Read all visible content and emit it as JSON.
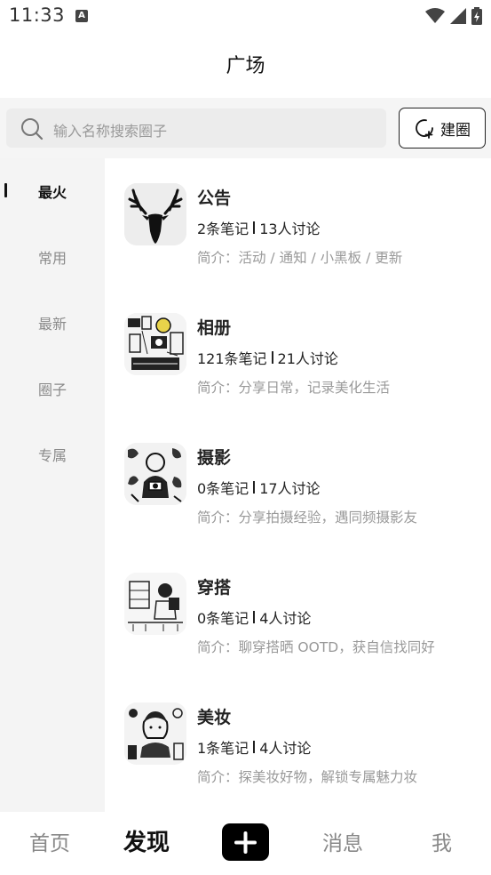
{
  "status_bar": {
    "time": "11:33",
    "app_icon_letter": "A",
    "icons": [
      "wifi-icon",
      "cellular-signal-icon",
      "battery-charging-icon"
    ]
  },
  "header": {
    "title": "广场"
  },
  "search": {
    "placeholder": "输入名称搜索圈子",
    "create_label": "建圈"
  },
  "sidebar": {
    "items": [
      {
        "label": "最火",
        "active": true
      },
      {
        "label": "常用",
        "active": false
      },
      {
        "label": "最新",
        "active": false
      },
      {
        "label": "圈子",
        "active": false
      },
      {
        "label": "专属",
        "active": false
      }
    ]
  },
  "circles": [
    {
      "name": "公告",
      "notes": "2条笔记",
      "discussions": "13人讨论",
      "desc": "简介：活动 / 通知 / 小黑板 / 更新",
      "avatar": "deer-logo"
    },
    {
      "name": "相册",
      "notes": "121条笔记",
      "discussions": "21人讨论",
      "desc": "简介：分享日常，记录美化生活",
      "avatar": "sketch-illustration"
    },
    {
      "name": "摄影",
      "notes": "0条笔记",
      "discussions": "17人讨论",
      "desc": "简介：分享拍摄经验，遇同频摄影友",
      "avatar": "sketch-illustration"
    },
    {
      "name": "穿搭",
      "notes": "0条笔记",
      "discussions": "4人讨论",
      "desc": "简介：聊穿搭晒 OOTD，获自信找同好",
      "avatar": "sketch-illustration"
    },
    {
      "name": "美妆",
      "notes": "1条笔记",
      "discussions": "4人讨论",
      "desc": "简介：探美妆好物，解锁专属魅力妆",
      "avatar": "sketch-illustration"
    }
  ],
  "bottom_nav": {
    "home": "首页",
    "discover": "发现",
    "messages": "消息",
    "me": "我"
  },
  "colors": {
    "accent": "#000000",
    "muted_text": "#999999",
    "sidebar_bg": "#f4f4f4"
  }
}
